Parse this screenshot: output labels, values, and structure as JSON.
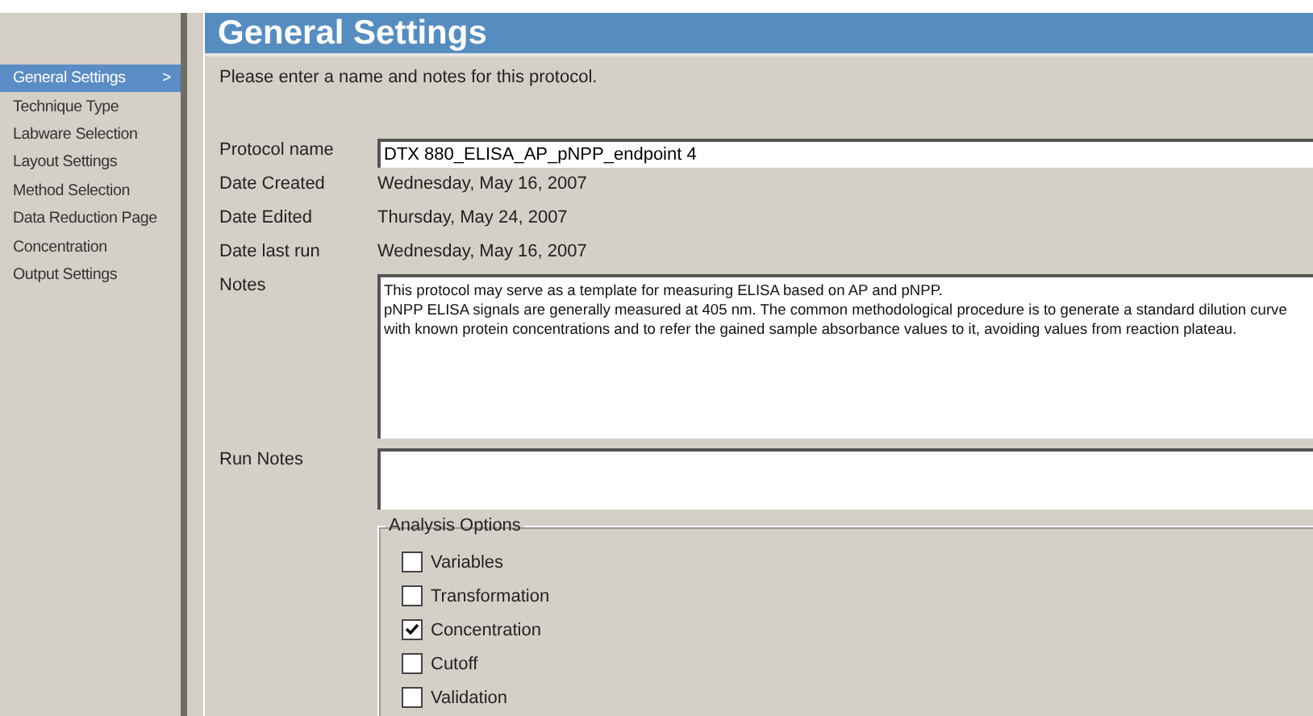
{
  "sidebar": {
    "items": [
      {
        "label": "General Settings",
        "selected": true,
        "arrow": ">"
      },
      {
        "label": "Technique Type",
        "selected": false
      },
      {
        "label": "Labware Selection",
        "selected": false
      },
      {
        "label": "Layout Settings",
        "selected": false
      },
      {
        "label": "Method Selection",
        "selected": false
      },
      {
        "label": "Data Reduction Page",
        "selected": false
      },
      {
        "label": "Concentration",
        "selected": false
      },
      {
        "label": "Output Settings",
        "selected": false
      }
    ]
  },
  "header": {
    "title": "General Settings"
  },
  "instruction": "Please enter a name and notes for this protocol.",
  "fields": [
    {
      "kind": "input",
      "label": "Protocol name",
      "value": "DTX 880_ELISA_AP_pNPP_endpoint 4"
    },
    {
      "kind": "text",
      "label": "Date Created",
      "value": "Wednesday, May 16, 2007"
    },
    {
      "kind": "text",
      "label": "Date Edited",
      "value": "Thursday, May 24, 2007"
    },
    {
      "kind": "text",
      "label": "Date last run",
      "value": "Wednesday, May 16, 2007"
    },
    {
      "kind": "notes",
      "label": "Notes",
      "value": "This protocol may serve as a template for measuring ELISA based on AP and pNPP.\npNPP ELISA signals are generally measured at 405 nm. The common methodological procedure is to generate a standard dilution curve with known protein concentrations and to refer the gained sample absorbance values to it, avoiding values from reaction plateau."
    },
    {
      "kind": "runnotes",
      "label": "Run Notes"
    }
  ],
  "analysis_options": {
    "title": "Analysis Options",
    "options": [
      {
        "label": "Variables",
        "checked": false
      },
      {
        "label": "Transformation",
        "checked": false
      },
      {
        "label": "Concentration",
        "checked": true
      },
      {
        "label": "Cutoff",
        "checked": false
      },
      {
        "label": "Validation",
        "checked": false
      }
    ]
  }
}
